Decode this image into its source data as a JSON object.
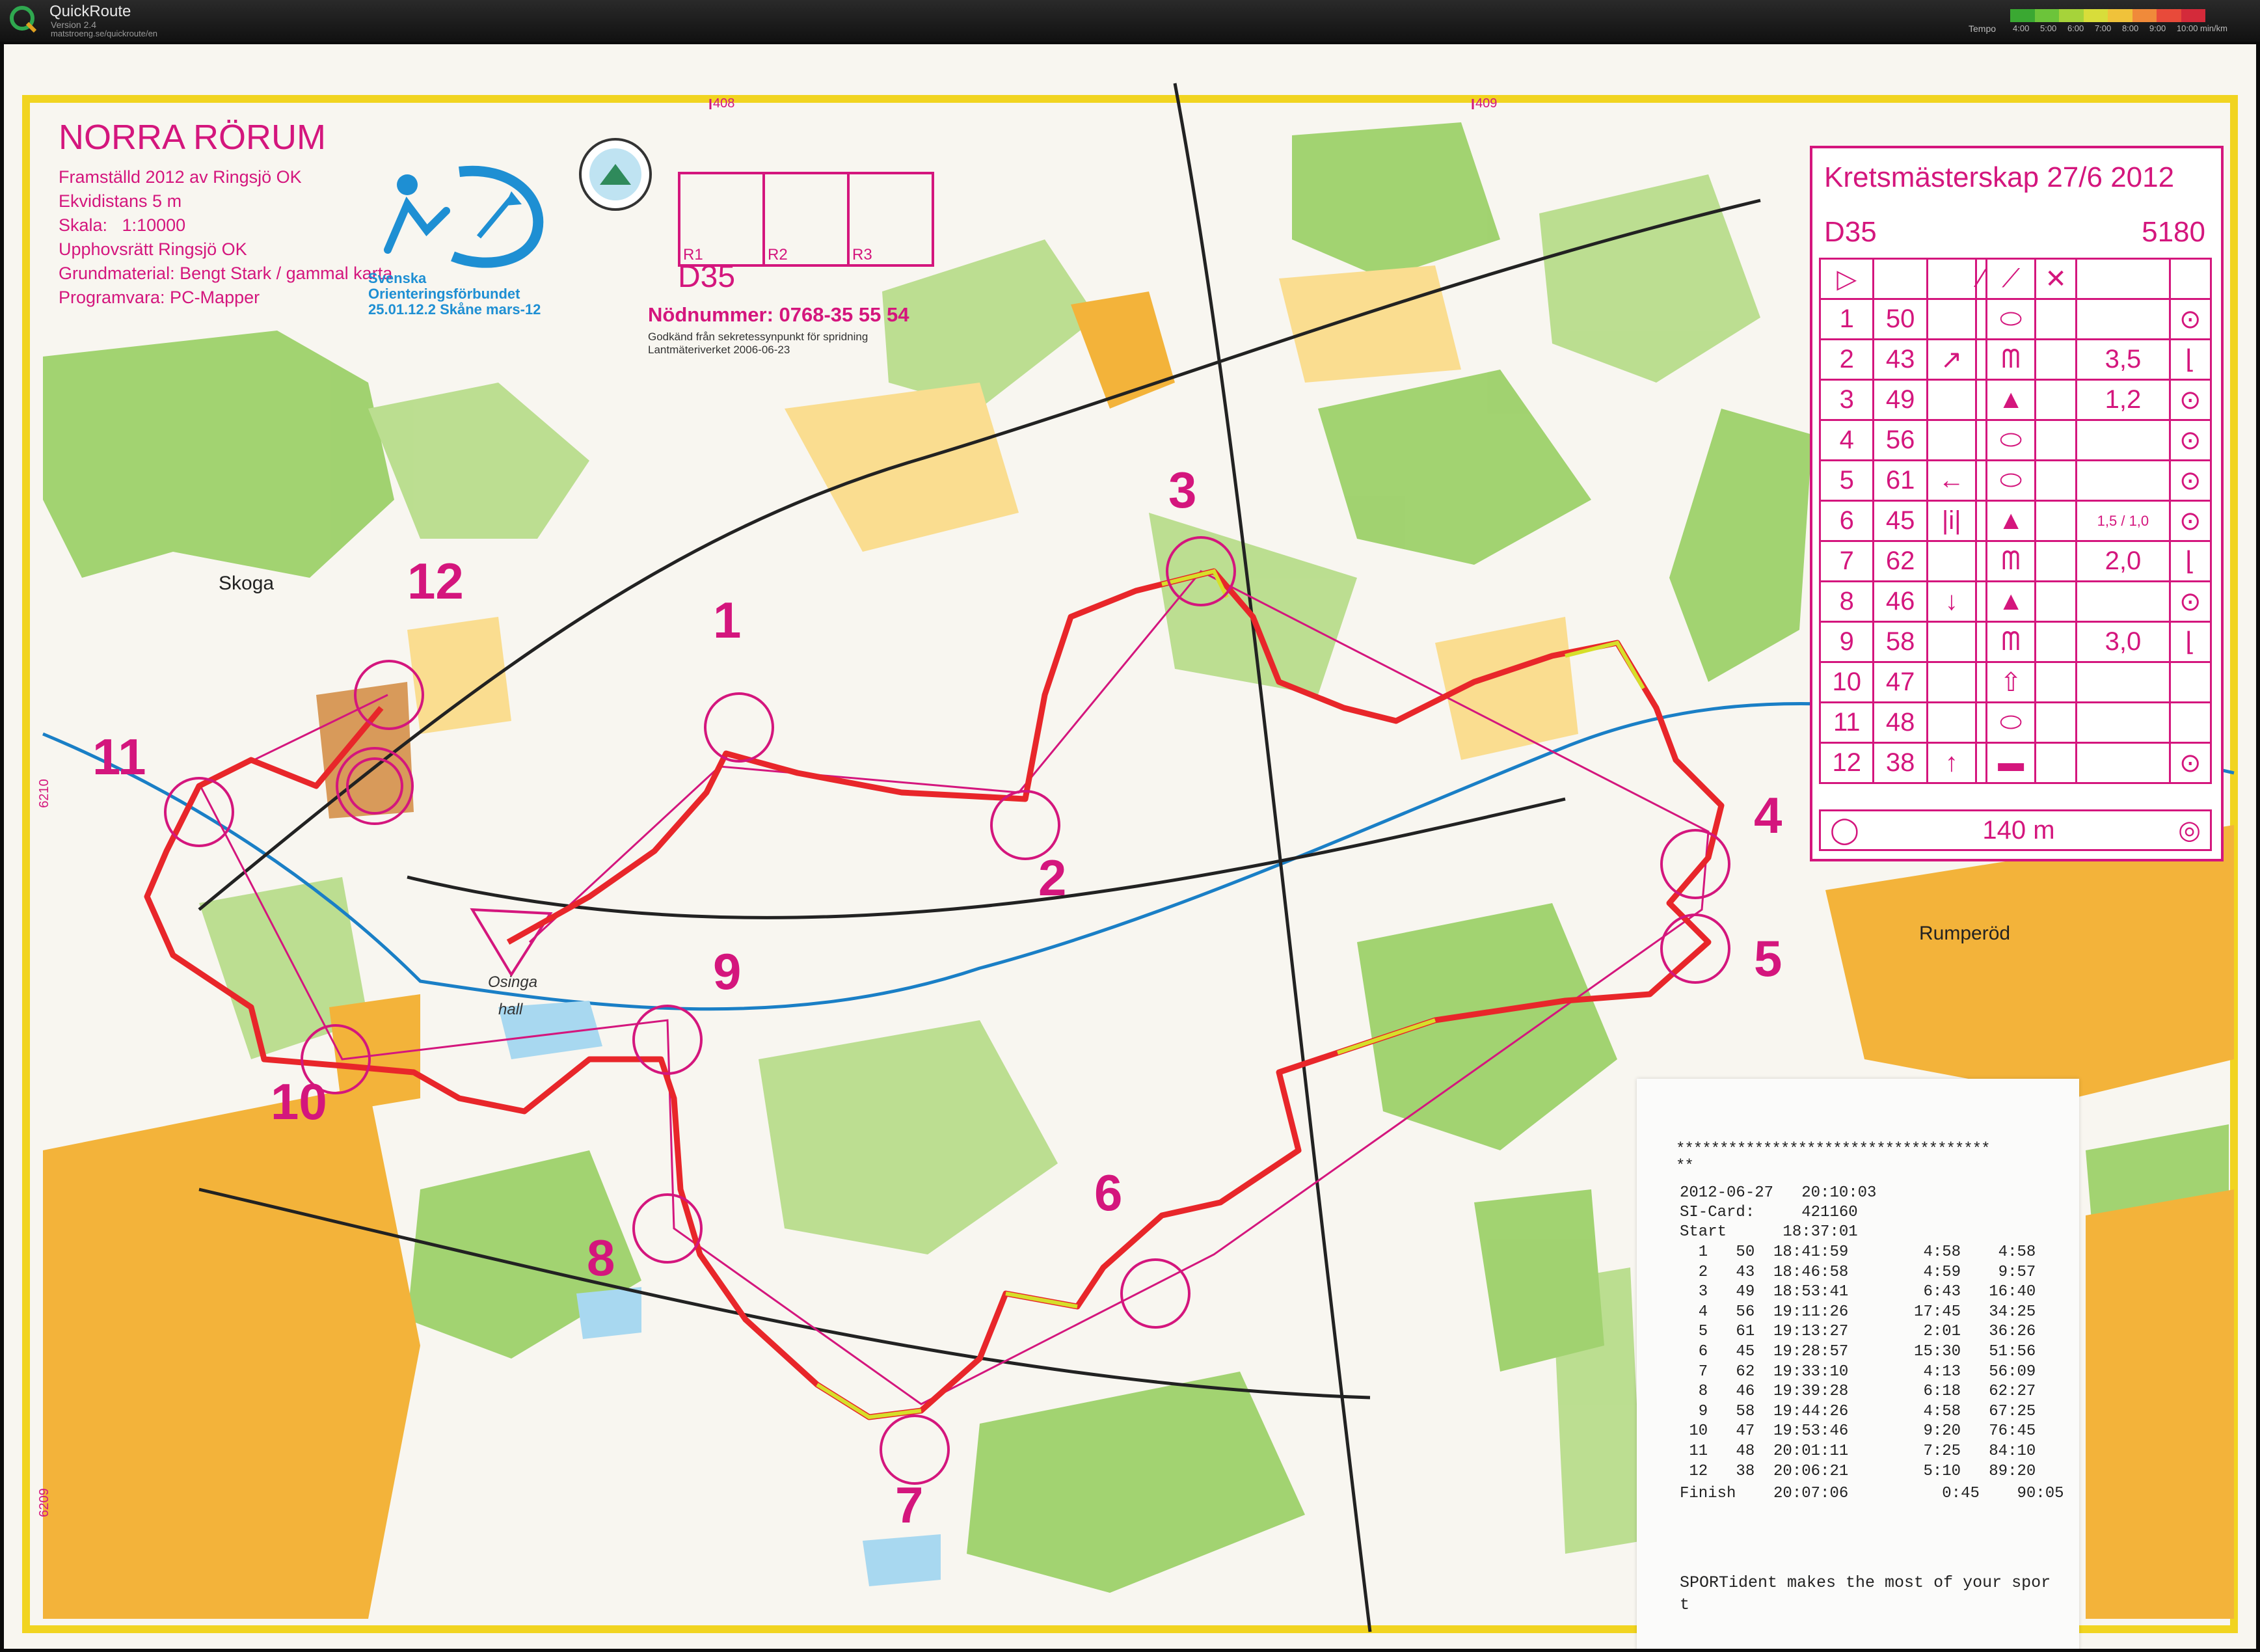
{
  "app": {
    "name": "QuickRoute",
    "version": "Version 2.4",
    "url": "matstroeng.se/quickroute/en",
    "tempo_label": "Tempo",
    "tempo_ticks": [
      "4:00",
      "5:00",
      "6:00",
      "7:00",
      "8:00",
      "9:00",
      "10:00 min/km"
    ],
    "tempo_colors": [
      "#3aa832",
      "#6cc43a",
      "#a6d33a",
      "#d8dd3a",
      "#f0c23a",
      "#f08a3a",
      "#e84a3a",
      "#d42a3a"
    ]
  },
  "map": {
    "title": "NORRA RÖRUM",
    "info": "Framställd 2012 av Ringsjö OK\nEkvidistans 5 m\nSkala:   1:10000\nUpphovsrätt Ringsjö OK\nGrundmaterial: Bengt Stark / gammal karta\nProgramvara: PC-Mapper",
    "federation": "Svenska\nOrienteringsförbundet\n25.01.12.2 Skåne mars-12",
    "class_label": "D35",
    "emergency": "Nödnummer: 0768-35 55 54",
    "approval": "Godkänd från sekretessynpunkt för spridning\nLantmäteriverket 2006-06-23",
    "grid_numbers": [
      "408",
      "409",
      "6210",
      "6209"
    ],
    "relay_boxes": [
      "R1",
      "R2",
      "R3"
    ],
    "places": {
      "skoga": "Skoga",
      "rumperod": "Rumperöd",
      "osinga": "Osinga",
      "hall": "hall"
    }
  },
  "controls": {
    "numbers": [
      "1",
      "2",
      "3",
      "4",
      "5",
      "6",
      "7",
      "8",
      "9",
      "10",
      "11",
      "12"
    ]
  },
  "description": {
    "title": "Kretsmästerskap 27/6 2012",
    "class": "D35",
    "length": "5180",
    "rows": [
      {
        "n": "1",
        "code": "50",
        "dir": "",
        "feature": "ellipse",
        "dim": "",
        "loc": "o"
      },
      {
        "n": "2",
        "code": "43",
        "dir": "↗",
        "feature": "comb",
        "dim": "3,5",
        "loc": "L"
      },
      {
        "n": "3",
        "code": "49",
        "dir": "",
        "feature": "triangle",
        "dim": "1,2",
        "loc": "o"
      },
      {
        "n": "4",
        "code": "56",
        "dir": "",
        "feature": "ellipse",
        "dim": "",
        "loc": "o"
      },
      {
        "n": "5",
        "code": "61",
        "dir": "←",
        "feature": "ellipse",
        "dim": "",
        "loc": "o"
      },
      {
        "n": "6",
        "code": "45",
        "dir": "|i|",
        "feature": "triangle",
        "dim": "1,5 / 1,0",
        "loc": "o"
      },
      {
        "n": "7",
        "code": "62",
        "dir": "",
        "feature": "comb",
        "dim": "2,0",
        "loc": "L"
      },
      {
        "n": "8",
        "code": "46",
        "dir": "↓",
        "feature": "triangle",
        "dim": "",
        "loc": "o"
      },
      {
        "n": "9",
        "code": "58",
        "dir": "",
        "feature": "comb",
        "dim": "3,0",
        "loc": "L"
      },
      {
        "n": "10",
        "code": "47",
        "dir": "",
        "feature": "arrowup",
        "dim": "",
        "loc": ""
      },
      {
        "n": "11",
        "code": "48",
        "dir": "",
        "feature": "ellipse",
        "dim": "",
        "loc": ""
      },
      {
        "n": "12",
        "code": "38",
        "dir": "↑",
        "feature": "rect",
        "dim": "",
        "loc": "o"
      }
    ],
    "finish": "140 m"
  },
  "receipt": {
    "stars": "************************************\n**",
    "datetime": "2012-06-27   20:10:03",
    "si_card": "SI-Card:     421160",
    "start": "Start      18:37:01",
    "splits": [
      [
        "1",
        "50",
        "18:41:59",
        "4:58",
        "4:58"
      ],
      [
        "2",
        "43",
        "18:46:58",
        "4:59",
        "9:57"
      ],
      [
        "3",
        "49",
        "18:53:41",
        "6:43",
        "16:40"
      ],
      [
        "4",
        "56",
        "19:11:26",
        "17:45",
        "34:25"
      ],
      [
        "5",
        "61",
        "19:13:27",
        "2:01",
        "36:26"
      ],
      [
        "6",
        "45",
        "19:28:57",
        "15:30",
        "51:56"
      ],
      [
        "7",
        "62",
        "19:33:10",
        "4:13",
        "56:09"
      ],
      [
        "8",
        "46",
        "19:39:28",
        "6:18",
        "62:27"
      ],
      [
        "9",
        "58",
        "19:44:26",
        "4:58",
        "67:25"
      ],
      [
        "10",
        "47",
        "19:53:46",
        "9:20",
        "76:45"
      ],
      [
        "11",
        "48",
        "20:01:11",
        "7:25",
        "84:10"
      ],
      [
        "12",
        "38",
        "20:06:21",
        "5:10",
        "89:20"
      ]
    ],
    "finish": "Finish    20:07:06          0:45    90:05",
    "footer": "SPORTident makes the most of your spor\nt"
  }
}
